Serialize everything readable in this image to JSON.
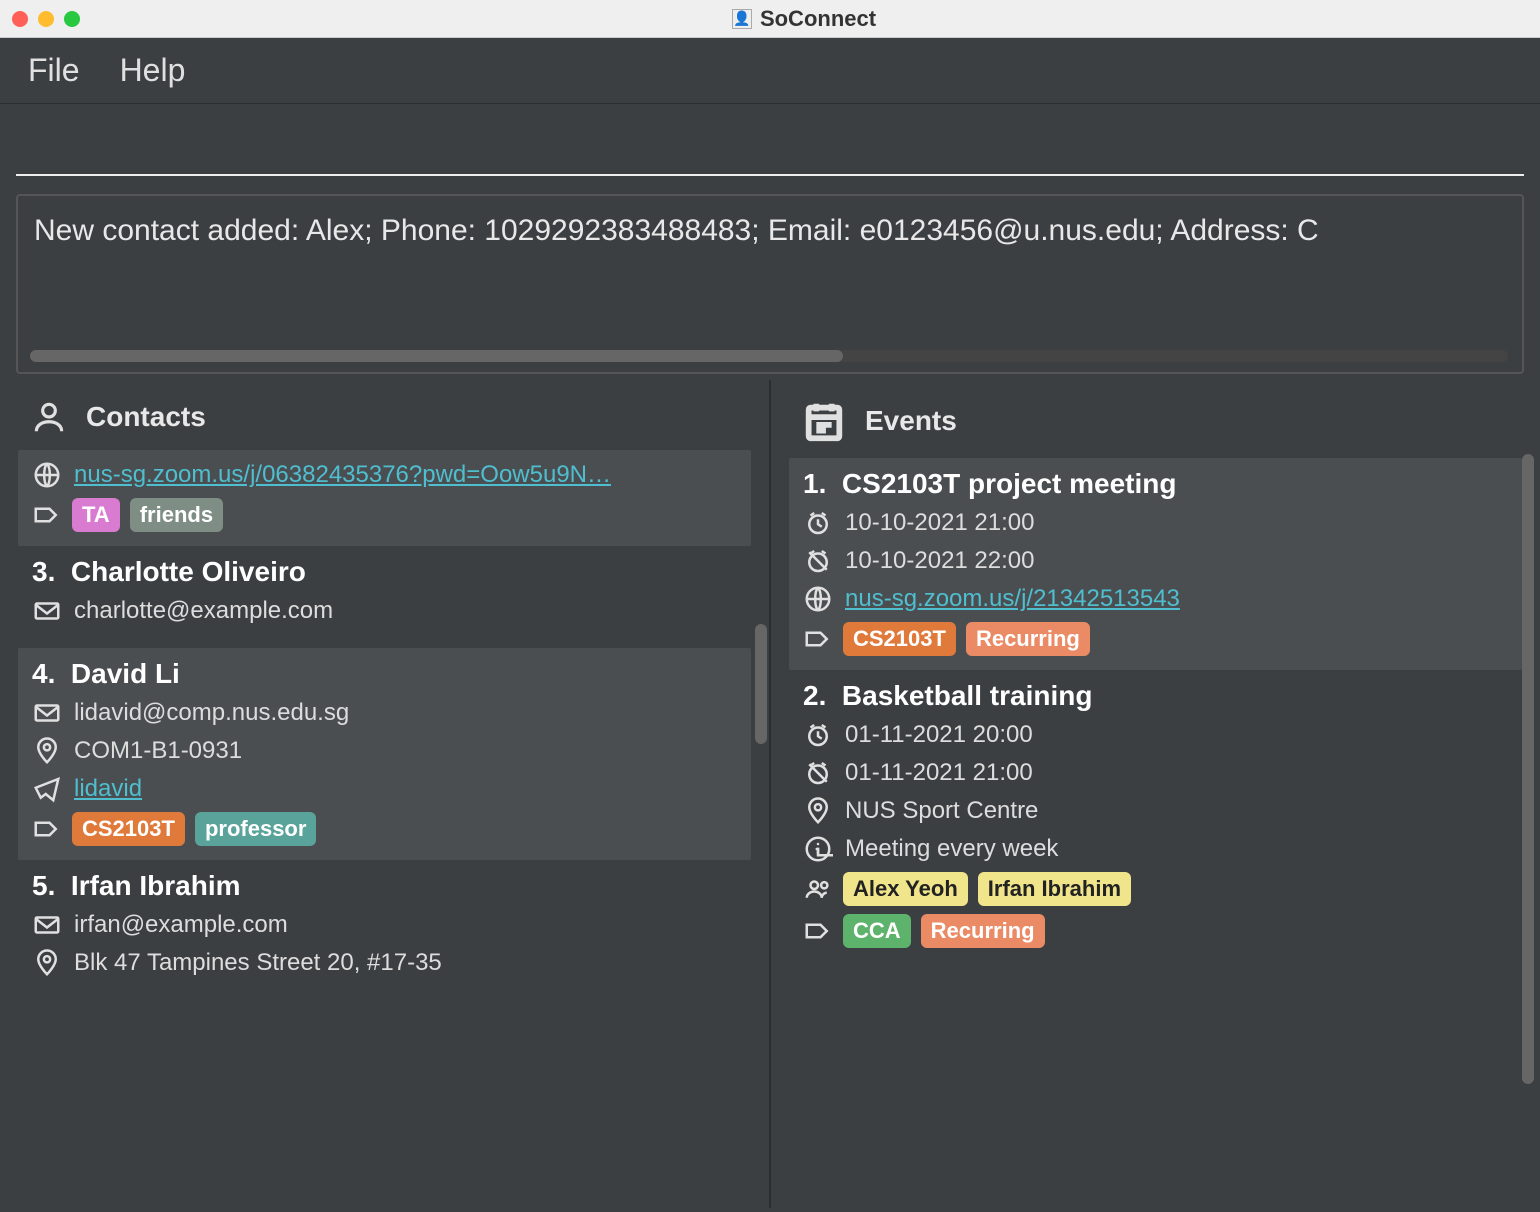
{
  "window": {
    "title": "SoConnect"
  },
  "menu": {
    "file": "File",
    "help": "Help"
  },
  "result": "New contact added: Alex; Phone: 1029292383488483; Email: e0123456@u.nus.edu; Address: C",
  "contacts_header": "Contacts",
  "events_header": "Events",
  "contacts_partial": {
    "zoom_link": "nus-sg.zoom.us/j/06382435376?pwd=Oow5u9N…",
    "tags": [
      "TA",
      "friends"
    ]
  },
  "contacts": [
    {
      "index": "3.",
      "name": "Charlotte Oliveiro",
      "email": "charlotte@example.com"
    },
    {
      "index": "4.",
      "name": "David Li",
      "email": "lidavid@comp.nus.edu.sg",
      "location": "COM1-B1-0931",
      "tg": "lidavid",
      "tags": [
        "CS2103T",
        "professor"
      ]
    },
    {
      "index": "5.",
      "name": "Irfan Ibrahim",
      "email": "irfan@example.com",
      "address": "Blk 47 Tampines Street 20, #17-35"
    }
  ],
  "events": [
    {
      "index": "1.",
      "name": "CS2103T project meeting",
      "start": "10-10-2021 21:00",
      "end": "10-10-2021 22:00",
      "link": "nus-sg.zoom.us/j/21342513543",
      "tags": [
        "CS2103T",
        "Recurring"
      ]
    },
    {
      "index": "2.",
      "name": "Basketball training",
      "start": "01-11-2021 20:00",
      "end": "01-11-2021 21:00",
      "location": "NUS Sport Centre",
      "note": "Meeting every week",
      "people": [
        "Alex Yeoh",
        "Irfan Ibrahim"
      ],
      "tags": [
        "CCA",
        "Recurring"
      ]
    }
  ]
}
